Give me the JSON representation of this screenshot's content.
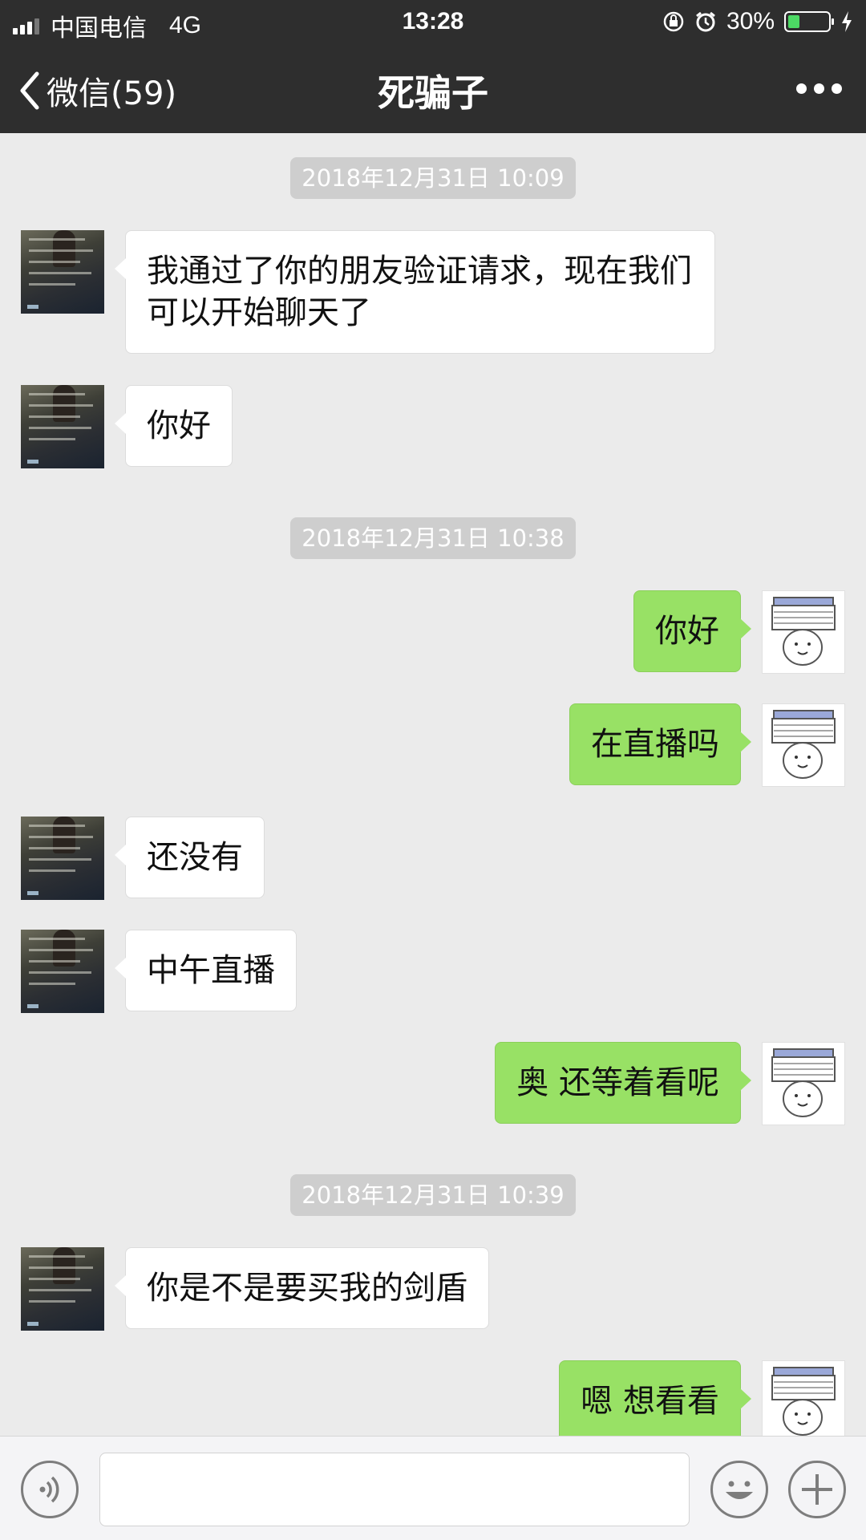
{
  "status_bar": {
    "carrier": "中国电信",
    "network": "4G",
    "time": "13:28",
    "battery": "30%",
    "battery_level": 0.3
  },
  "nav": {
    "back_label": "微信(59)",
    "title": "死骗子"
  },
  "timestamps": [
    "2018年12月31日 10:09",
    "2018年12月31日 10:38",
    "2018年12月31日 10:39"
  ],
  "messages": [
    {
      "side": "in",
      "text": "我通过了你的朋友验证请求，现在我们可以开始聊天了"
    },
    {
      "side": "in",
      "text": "你好"
    },
    {
      "side": "out",
      "text": "你好"
    },
    {
      "side": "out",
      "text": "在直播吗"
    },
    {
      "side": "in",
      "text": "还没有"
    },
    {
      "side": "in",
      "text": "中午直播"
    },
    {
      "side": "out",
      "text": "奥 还等着看呢"
    },
    {
      "side": "in",
      "text": "你是不是要买我的剑盾"
    },
    {
      "side": "out",
      "text": "嗯 想看看"
    }
  ],
  "input": {
    "placeholder": ""
  },
  "colors": {
    "bar_bg": "#2e2e2e",
    "chat_bg": "#ebebeb",
    "out_bubble": "#98e165",
    "in_bubble": "#ffffff",
    "timestamp_bg": "#cecece"
  },
  "icons": [
    "signal-icon",
    "orientation-lock-icon",
    "alarm-icon",
    "battery-icon",
    "charging-icon",
    "back-chevron-icon",
    "more-icon",
    "voice-icon",
    "emoji-icon",
    "plus-icon"
  ]
}
